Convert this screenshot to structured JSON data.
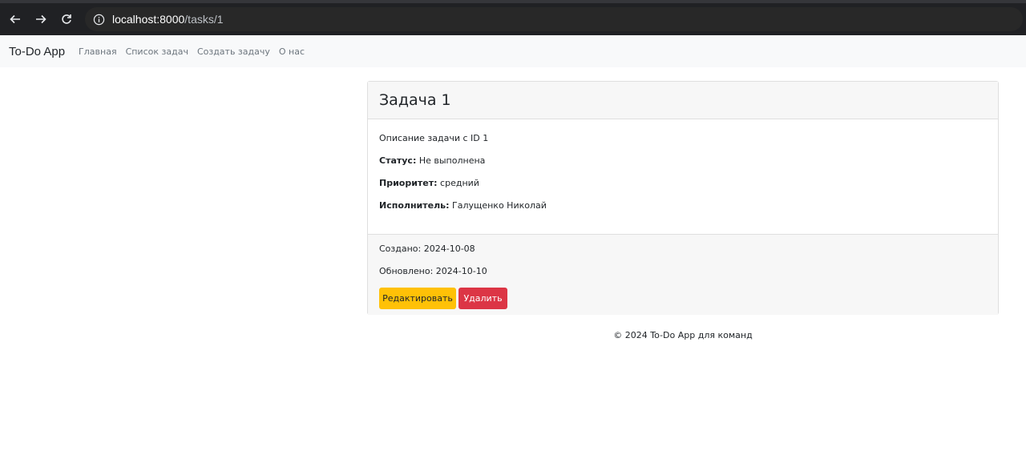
{
  "browser": {
    "url_host": "localhost:8000",
    "url_path": "/tasks/1"
  },
  "navbar": {
    "brand": "To-Do App",
    "links": [
      "Главная",
      "Список задач",
      "Создать задачу",
      "О нас"
    ]
  },
  "task": {
    "title": "Задача 1",
    "description": "Описание задачи с ID 1",
    "status_label": "Статус:",
    "status_value": "Не выполнена",
    "priority_label": "Приоритет:",
    "priority_value": "средний",
    "assignee_label": "Исполнитель:",
    "assignee_value": "Галущенко Николай",
    "created": "Создано: 2024-10-08",
    "updated": "Обновлено: 2024-10-10",
    "edit_label": "Редактировать",
    "delete_label": "Удалить"
  },
  "footer": {
    "text": "© 2024 To-Do App для команд"
  },
  "colors": {
    "edit_button": "#ffc107",
    "delete_button": "#dc3545",
    "navbar_bg": "#f8f9fa",
    "browser_bg": "#202124"
  }
}
